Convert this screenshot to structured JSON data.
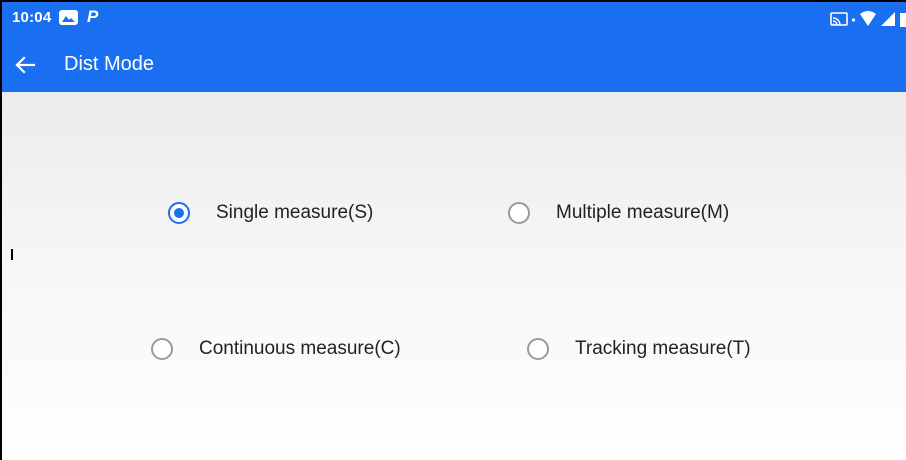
{
  "status_bar": {
    "time": "10:04",
    "p_glyph": "P",
    "icons": [
      "gallery-icon",
      "parking-icon",
      "cast-icon",
      "wifi-icon",
      "signal-icon",
      "battery-icon"
    ]
  },
  "app_bar": {
    "title": "Dist Mode",
    "back_icon": "arrow-left-icon"
  },
  "options": [
    {
      "label": "Single measure(S)",
      "checked": true
    },
    {
      "label": "Multiple measure(M)",
      "checked": false
    },
    {
      "label": "Continuous measure(C)",
      "checked": false
    },
    {
      "label": "Tracking measure(T)",
      "checked": false
    }
  ],
  "colors": {
    "accent": "#1a6ff0",
    "radio_off": "#9a9a9a",
    "text": "#222222"
  }
}
